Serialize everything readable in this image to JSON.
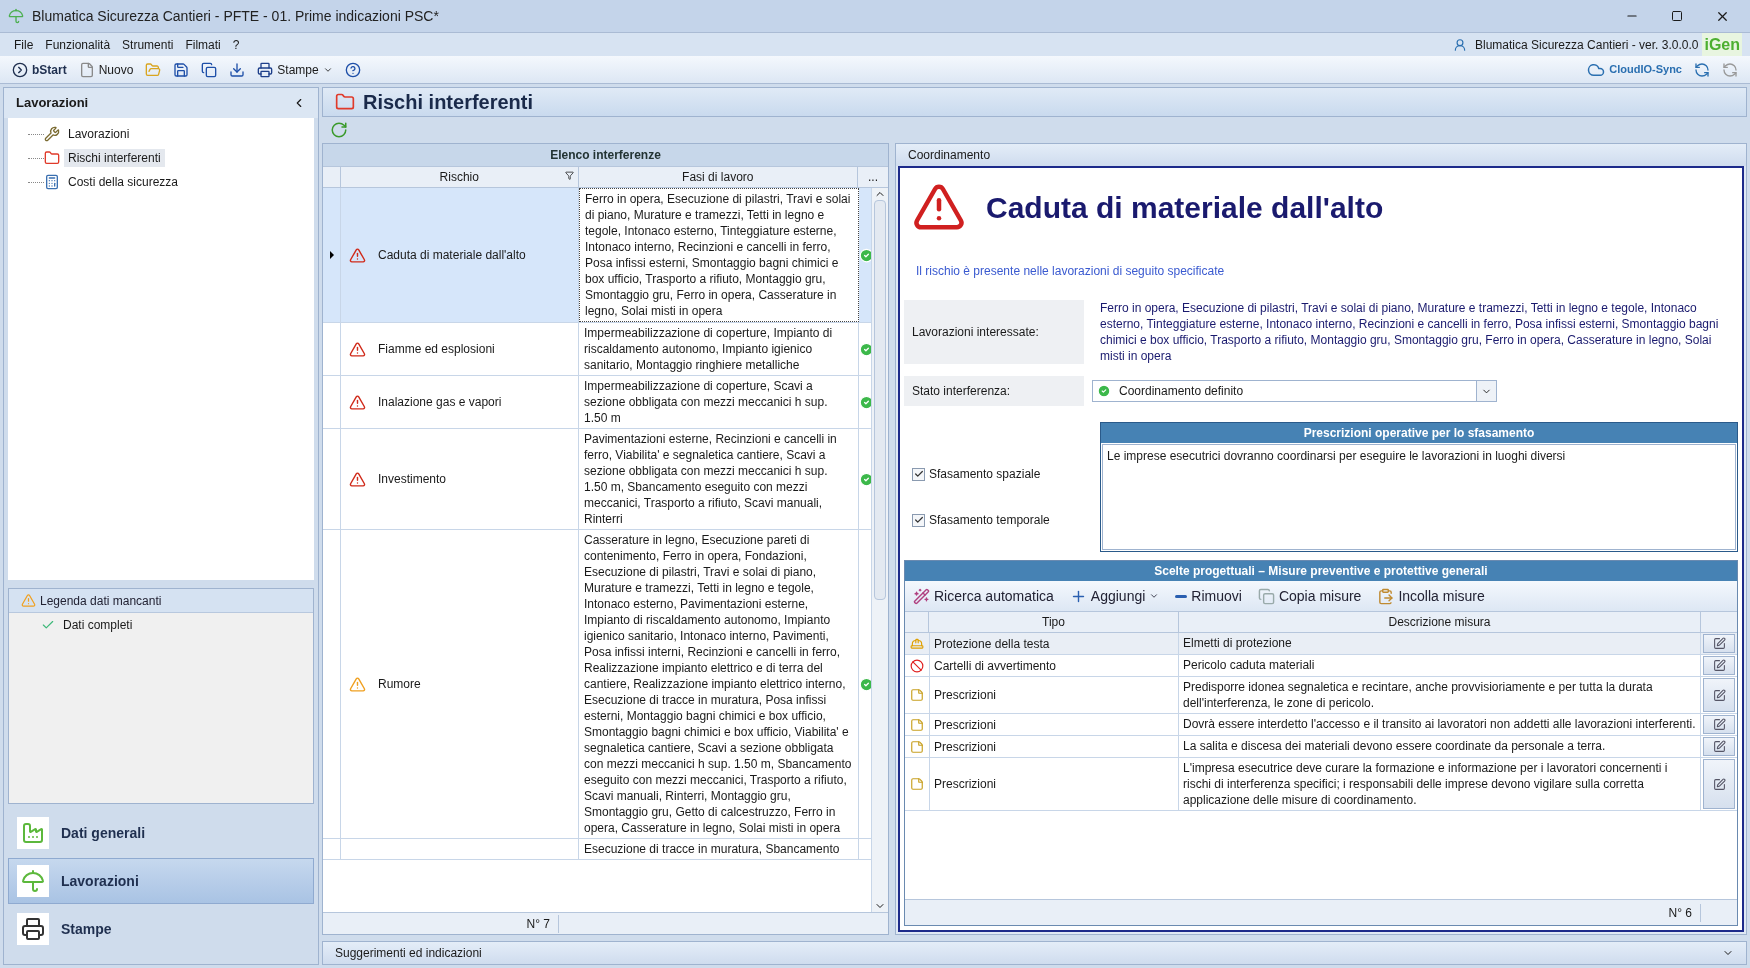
{
  "window": {
    "title": "Blumatica Sicurezza Cantieri - PFTE - 01. Prime indicazioni PSC*"
  },
  "menu": {
    "items": [
      "File",
      "Funzionalità",
      "Strumenti",
      "Filmati",
      "?"
    ],
    "version": "Blumatica Sicurezza Cantieri - ver. 3.0.0.0",
    "logo": "iGen"
  },
  "toolbar": {
    "items": [
      {
        "kind": "start",
        "label": "bStart"
      },
      {
        "kind": "new",
        "label": "Nuovo"
      },
      {
        "kind": "open"
      },
      {
        "kind": "save"
      },
      {
        "kind": "saveall"
      },
      {
        "kind": "saveas"
      },
      {
        "kind": "print",
        "label": "Stampe",
        "dropdown": true
      },
      {
        "kind": "help"
      }
    ],
    "sync": "CloudIO-Sync"
  },
  "sidebar": {
    "title": "Lavorazioni",
    "items": [
      {
        "kind": "work",
        "label": "Lavorazioni",
        "selected": false
      },
      {
        "kind": "risk",
        "label": "Rischi interferenti",
        "selected": true
      },
      {
        "kind": "cost",
        "label": "Costi della sicurezza",
        "selected": false
      }
    ],
    "legend": {
      "title": "Legenda dati mancanti",
      "items": [
        "Dati completi"
      ]
    },
    "nav": [
      {
        "kind": "factory",
        "label": "Dati generali",
        "selected": false
      },
      {
        "kind": "umbrella",
        "label": "Lavorazioni",
        "selected": true
      },
      {
        "kind": "printer",
        "label": "Stampe",
        "selected": false
      }
    ]
  },
  "page": {
    "title": "Rischi interferenti"
  },
  "interferences": {
    "title": "Elenco interferenze",
    "columns": [
      "Rischio",
      "Fasi di lavoro",
      "..."
    ],
    "rows": [
      {
        "risk": "Caduta di materiale dall'alto",
        "kind": "danger",
        "complete": true,
        "selected": true,
        "phases": "Ferro in opera, Esecuzione di pilastri, Travi e solai di piano, Murature e tramezzi, Tetti in legno e tegole, Intonaco esterno, Tinteggiature esterne, Intonaco interno, Recinzioni e cancelli in ferro, Posa infissi esterni, Smontaggio bagni chimici e box ufficio, Trasporto a rifiuto, Montaggio gru, Smontaggio gru, Ferro in opera, Casserature in legno, Solai misti in opera"
      },
      {
        "risk": "Fiamme ed esplosioni",
        "kind": "danger",
        "complete": true,
        "selected": false,
        "phases": "Impermeabilizzazione di coperture, Impianto di riscaldamento autonomo, Impianto igienico sanitario, Montaggio ringhiere metalliche"
      },
      {
        "risk": "Inalazione gas e vapori",
        "kind": "danger",
        "complete": true,
        "selected": false,
        "phases": "Impermeabilizzazione di coperture, Scavi a sezione obbligata con mezzi meccanici h sup. 1.50 m"
      },
      {
        "risk": "Investimento",
        "kind": "danger",
        "complete": true,
        "selected": false,
        "phases": "Pavimentazioni esterne, Recinzioni e cancelli in ferro, Viabilita' e segnaletica cantiere, Scavi a sezione obbligata con mezzi meccanici h sup. 1.50 m, Sbancamento eseguito con mezzi meccanici, Trasporto a rifiuto, Scavi manuali, Rinterri"
      },
      {
        "risk": "Rumore",
        "kind": "warning",
        "complete": true,
        "selected": false,
        "phases": "Casserature in legno, Esecuzione pareti di contenimento, Ferro in opera, Fondazioni, Esecuzione di pilastri, Travi e solai di piano, Murature e tramezzi, Tetti in legno e tegole, Intonaco esterno, Pavimentazioni esterne, Impianto di riscaldamento autonomo, Impianto igienico sanitario, Intonaco interno, Pavimenti, Posa infissi interni, Recinzioni e cancelli in ferro, Realizzazione impianto elettrico e di terra del cantiere, Realizzazione impianto elettrico interno, Esecuzione di tracce in muratura, Posa infissi esterni, Montaggio bagni chimici e box ufficio, Smontaggio bagni chimici e box ufficio, Viabilita' e segnaletica cantiere, Scavi a sezione obbligata con mezzi meccanici h sup. 1.50 m, Sbancamento eseguito con mezzi meccanici, Trasporto a rifiuto, Scavi manuali, Rinterri, Montaggio gru, Smontaggio gru, Getto di calcestruzzo, Ferro in opera, Casserature in legno, Solai misti in opera"
      },
      {
        "kind": "partial",
        "selected": false,
        "phases": "Esecuzione di tracce in muratura, Sbancamento"
      }
    ],
    "count": "N° 7"
  },
  "detail": {
    "header": "Coordinamento",
    "title": "Caduta di materiale dall'alto",
    "intro": "Il rischio è presente nelle lavorazioni di seguito specificate",
    "works_label": "Lavorazioni interessate:",
    "works": "Ferro in opera, Esecuzione di pilastri, Travi e solai di piano, Murature e tramezzi, Tetti in legno e tegole, Intonaco esterno, Tinteggiature esterne, Intonaco interno, Recinzioni e cancelli in ferro, Posa infissi esterni, Smontaggio bagni chimici e box ufficio, Trasporto a rifiuto, Montaggio gru, Smontaggio gru, Ferro in opera, Casserature in legno, Solai misti in opera",
    "status_label": "Stato interferenza:",
    "status": "Coordinamento definito",
    "checks": [
      {
        "label": "Sfasamento spaziale",
        "checked": true
      },
      {
        "label": "Sfasamento temporale",
        "checked": true
      }
    ],
    "prescriptions": {
      "title": "Prescrizioni operative per lo sfasamento",
      "text": "Le imprese esecutrici dovranno coordinarsi per eseguire le lavorazioni in luoghi diversi"
    },
    "measures": {
      "title": "Scelte progettuali – Misure preventive e protettive generali",
      "tools": [
        {
          "kind": "wand",
          "label": "Ricerca automatica"
        },
        {
          "kind": "add",
          "label": "Aggiungi",
          "dropdown": true
        },
        {
          "kind": "remove",
          "label": "Rimuovi"
        },
        {
          "kind": "copy",
          "label": "Copia misure"
        },
        {
          "kind": "paste",
          "label": "Incolla misure"
        }
      ],
      "columns": [
        "Tipo",
        "Descrizione misura"
      ],
      "rows": [
        {
          "kind": "helmet",
          "type": "Protezione della testa",
          "description": "Elmetti di protezione"
        },
        {
          "kind": "sign",
          "type": "Cartelli di avvertimento",
          "description": "Pericolo caduta materiali"
        },
        {
          "kind": "note",
          "type": "Prescrizioni",
          "description": "Predisporre idonea segnaletica e recintare, anche provvisioriamente e per tutta la durata dell'interferenza, le zone di pericolo."
        },
        {
          "kind": "note",
          "type": "Prescrizioni",
          "description": "Dovrà essere interdetto l'accesso e il transito ai lavoratori non addetti alle lavorazioni interferenti."
        },
        {
          "kind": "note",
          "type": "Prescrizioni",
          "description": "La salita e discesa dei materiali devono essere coordinate da personale a terra."
        },
        {
          "kind": "note",
          "type": "Prescrizioni",
          "description": "L'impresa esecutrice deve curare la formazione e informazione per i lavoratori concernenti i rischi di interferenza specifici; i responsabili delle imprese devono vigilare sulla corretta applicazione delle misure di coordinamento."
        }
      ],
      "count": "N° 6"
    }
  },
  "bottom": {
    "label": "Suggerimenti ed indicazioni"
  }
}
